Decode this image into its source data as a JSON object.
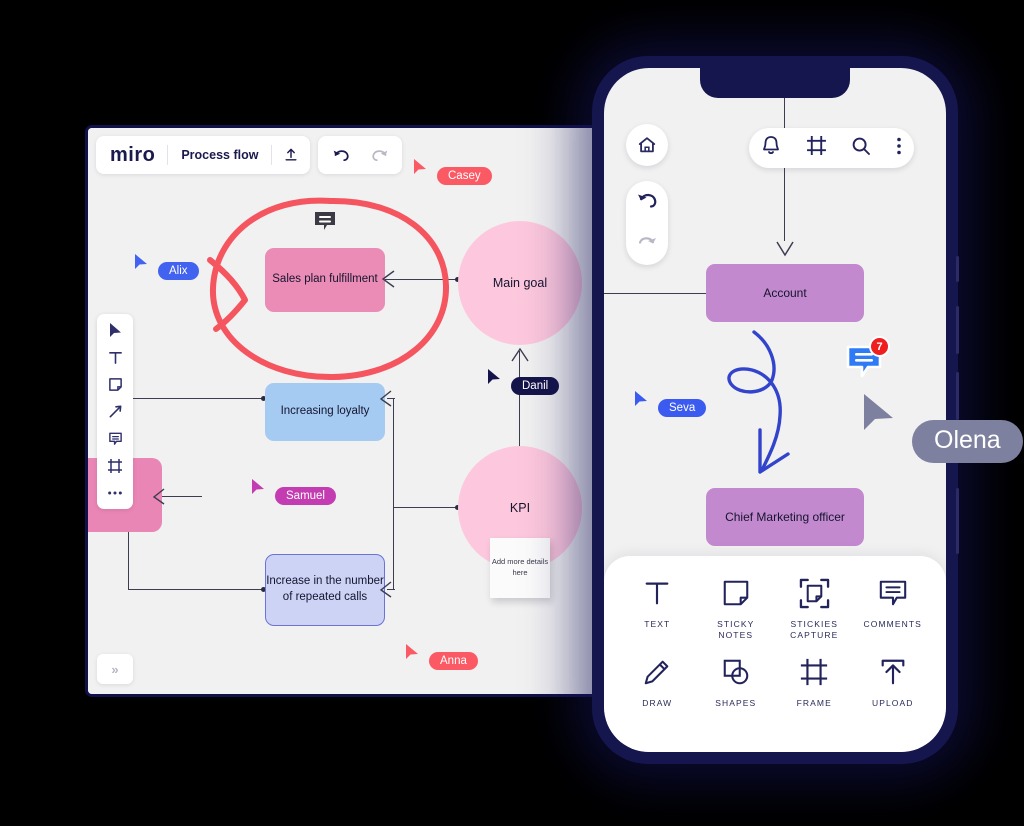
{
  "board": {
    "logo": "miro",
    "title": "Process flow",
    "icons": {
      "upload": "upload-icon",
      "undo": "undo-icon",
      "redo": "redo-icon"
    },
    "rail": [
      {
        "name": "cursor-tool",
        "label": "Select"
      },
      {
        "name": "text-tool",
        "label": "Text"
      },
      {
        "name": "sticky-note-tool",
        "label": "Sticky note"
      },
      {
        "name": "pen-tool",
        "label": "Pen"
      },
      {
        "name": "comment-tool",
        "label": "Comment"
      },
      {
        "name": "frame-tool",
        "label": "Frame"
      },
      {
        "name": "more-tools",
        "label": "More"
      }
    ],
    "expand_label": "»",
    "nodes": {
      "sales": "Sales plan fulfillment",
      "main_goal": "Main goal",
      "loyalty": "Increasing loyalty",
      "kpi": "KPI",
      "repeated": "Increase in the number of repeated calls",
      "sticky": "Add more details here"
    },
    "cursors": [
      {
        "name": "Alix",
        "color": "#4262f0"
      },
      {
        "name": "Casey",
        "color": "#fb5a65"
      },
      {
        "name": "Danil",
        "color": "#14144a"
      },
      {
        "name": "Samuel",
        "color": "#c43cb2"
      },
      {
        "name": "Anna",
        "color": "#fb5a65"
      }
    ],
    "annotation_color": "#f4555f"
  },
  "phone": {
    "top_icons": [
      {
        "name": "bell-icon",
        "label": "Notifications"
      },
      {
        "name": "frame-icon",
        "label": "Frames"
      },
      {
        "name": "search-icon",
        "label": "Search"
      },
      {
        "name": "kebab-menu-icon",
        "label": "More"
      }
    ],
    "home_icon": "home-icon",
    "undo_icon": "undo-icon",
    "redo_icon": "redo-icon",
    "nodes": {
      "account": "Account",
      "cmo": "Chief Marketing officer"
    },
    "comment_badge_count": "7",
    "cursors": [
      {
        "name": "Seva",
        "color": "#3b5bf0"
      },
      {
        "name": "Olena",
        "color": "#7e80a0"
      }
    ],
    "tools": [
      {
        "icon": "text-icon",
        "label": "TEXT"
      },
      {
        "icon": "sticky-notes-icon",
        "label": "STICKY\nNOTES"
      },
      {
        "icon": "stickies-capture-icon",
        "label": "STICKIES\nCAPTURE"
      },
      {
        "icon": "comments-icon",
        "label": "COMMENTS"
      },
      {
        "icon": "draw-icon",
        "label": "DRAW"
      },
      {
        "icon": "shapes-icon",
        "label": "SHAPES"
      },
      {
        "icon": "frame-icon",
        "label": "FRAME"
      },
      {
        "icon": "upload-icon",
        "label": "UPLOAD"
      }
    ],
    "drawing_color": "#3344cc"
  }
}
